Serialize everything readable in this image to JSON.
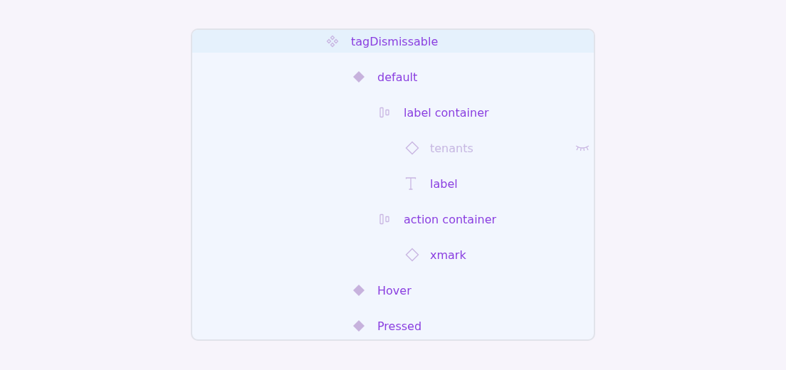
{
  "layers": [
    {
      "kind": "component_set",
      "name": "tagDismissable",
      "selected": true,
      "hidden": false,
      "children": [
        {
          "kind": "variant",
          "name": "default",
          "selected": false,
          "hidden": false,
          "children": [
            {
              "kind": "frame",
              "name": "label container",
              "selected": false,
              "hidden": false,
              "children": [
                {
                  "kind": "instance",
                  "name": "tenants",
                  "selected": false,
                  "hidden": true
                },
                {
                  "kind": "text",
                  "name": "label",
                  "selected": false,
                  "hidden": false
                }
              ]
            },
            {
              "kind": "frame",
              "name": "action container",
              "selected": false,
              "hidden": false,
              "children": [
                {
                  "kind": "instance",
                  "name": "xmark",
                  "selected": false,
                  "hidden": false
                }
              ]
            }
          ]
        },
        {
          "kind": "variant",
          "name": "Hover",
          "selected": false,
          "hidden": false
        },
        {
          "kind": "variant",
          "name": "Pressed",
          "selected": false,
          "hidden": false
        }
      ]
    }
  ]
}
